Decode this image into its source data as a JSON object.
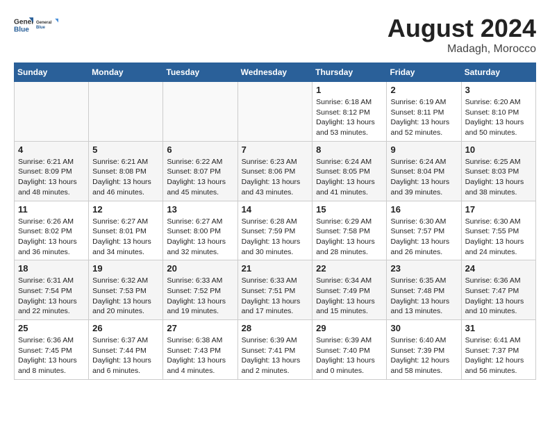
{
  "logo": {
    "general": "General",
    "blue": "Blue"
  },
  "title": "August 2024",
  "location": "Madagh, Morocco",
  "days_of_week": [
    "Sunday",
    "Monday",
    "Tuesday",
    "Wednesday",
    "Thursday",
    "Friday",
    "Saturday"
  ],
  "weeks": [
    [
      {
        "day": "",
        "info": ""
      },
      {
        "day": "",
        "info": ""
      },
      {
        "day": "",
        "info": ""
      },
      {
        "day": "",
        "info": ""
      },
      {
        "day": "1",
        "info": "Sunrise: 6:18 AM\nSunset: 8:12 PM\nDaylight: 13 hours\nand 53 minutes."
      },
      {
        "day": "2",
        "info": "Sunrise: 6:19 AM\nSunset: 8:11 PM\nDaylight: 13 hours\nand 52 minutes."
      },
      {
        "day": "3",
        "info": "Sunrise: 6:20 AM\nSunset: 8:10 PM\nDaylight: 13 hours\nand 50 minutes."
      }
    ],
    [
      {
        "day": "4",
        "info": "Sunrise: 6:21 AM\nSunset: 8:09 PM\nDaylight: 13 hours\nand 48 minutes."
      },
      {
        "day": "5",
        "info": "Sunrise: 6:21 AM\nSunset: 8:08 PM\nDaylight: 13 hours\nand 46 minutes."
      },
      {
        "day": "6",
        "info": "Sunrise: 6:22 AM\nSunset: 8:07 PM\nDaylight: 13 hours\nand 45 minutes."
      },
      {
        "day": "7",
        "info": "Sunrise: 6:23 AM\nSunset: 8:06 PM\nDaylight: 13 hours\nand 43 minutes."
      },
      {
        "day": "8",
        "info": "Sunrise: 6:24 AM\nSunset: 8:05 PM\nDaylight: 13 hours\nand 41 minutes."
      },
      {
        "day": "9",
        "info": "Sunrise: 6:24 AM\nSunset: 8:04 PM\nDaylight: 13 hours\nand 39 minutes."
      },
      {
        "day": "10",
        "info": "Sunrise: 6:25 AM\nSunset: 8:03 PM\nDaylight: 13 hours\nand 38 minutes."
      }
    ],
    [
      {
        "day": "11",
        "info": "Sunrise: 6:26 AM\nSunset: 8:02 PM\nDaylight: 13 hours\nand 36 minutes."
      },
      {
        "day": "12",
        "info": "Sunrise: 6:27 AM\nSunset: 8:01 PM\nDaylight: 13 hours\nand 34 minutes."
      },
      {
        "day": "13",
        "info": "Sunrise: 6:27 AM\nSunset: 8:00 PM\nDaylight: 13 hours\nand 32 minutes."
      },
      {
        "day": "14",
        "info": "Sunrise: 6:28 AM\nSunset: 7:59 PM\nDaylight: 13 hours\nand 30 minutes."
      },
      {
        "day": "15",
        "info": "Sunrise: 6:29 AM\nSunset: 7:58 PM\nDaylight: 13 hours\nand 28 minutes."
      },
      {
        "day": "16",
        "info": "Sunrise: 6:30 AM\nSunset: 7:57 PM\nDaylight: 13 hours\nand 26 minutes."
      },
      {
        "day": "17",
        "info": "Sunrise: 6:30 AM\nSunset: 7:55 PM\nDaylight: 13 hours\nand 24 minutes."
      }
    ],
    [
      {
        "day": "18",
        "info": "Sunrise: 6:31 AM\nSunset: 7:54 PM\nDaylight: 13 hours\nand 22 minutes."
      },
      {
        "day": "19",
        "info": "Sunrise: 6:32 AM\nSunset: 7:53 PM\nDaylight: 13 hours\nand 20 minutes."
      },
      {
        "day": "20",
        "info": "Sunrise: 6:33 AM\nSunset: 7:52 PM\nDaylight: 13 hours\nand 19 minutes."
      },
      {
        "day": "21",
        "info": "Sunrise: 6:33 AM\nSunset: 7:51 PM\nDaylight: 13 hours\nand 17 minutes."
      },
      {
        "day": "22",
        "info": "Sunrise: 6:34 AM\nSunset: 7:49 PM\nDaylight: 13 hours\nand 15 minutes."
      },
      {
        "day": "23",
        "info": "Sunrise: 6:35 AM\nSunset: 7:48 PM\nDaylight: 13 hours\nand 13 minutes."
      },
      {
        "day": "24",
        "info": "Sunrise: 6:36 AM\nSunset: 7:47 PM\nDaylight: 13 hours\nand 10 minutes."
      }
    ],
    [
      {
        "day": "25",
        "info": "Sunrise: 6:36 AM\nSunset: 7:45 PM\nDaylight: 13 hours\nand 8 minutes."
      },
      {
        "day": "26",
        "info": "Sunrise: 6:37 AM\nSunset: 7:44 PM\nDaylight: 13 hours\nand 6 minutes."
      },
      {
        "day": "27",
        "info": "Sunrise: 6:38 AM\nSunset: 7:43 PM\nDaylight: 13 hours\nand 4 minutes."
      },
      {
        "day": "28",
        "info": "Sunrise: 6:39 AM\nSunset: 7:41 PM\nDaylight: 13 hours\nand 2 minutes."
      },
      {
        "day": "29",
        "info": "Sunrise: 6:39 AM\nSunset: 7:40 PM\nDaylight: 13 hours\nand 0 minutes."
      },
      {
        "day": "30",
        "info": "Sunrise: 6:40 AM\nSunset: 7:39 PM\nDaylight: 12 hours\nand 58 minutes."
      },
      {
        "day": "31",
        "info": "Sunrise: 6:41 AM\nSunset: 7:37 PM\nDaylight: 12 hours\nand 56 minutes."
      }
    ]
  ]
}
